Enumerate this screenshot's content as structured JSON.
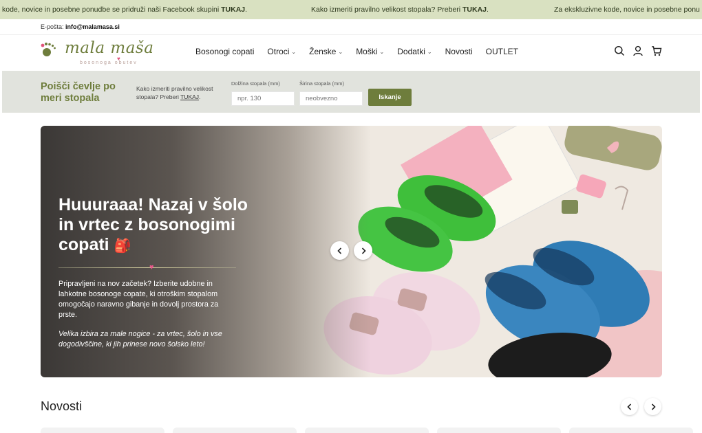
{
  "announcement": {
    "items": [
      {
        "prefix": "kode, novice in posebne ponudbe se pridruži naši Facebook skupini ",
        "bold": "TUKAJ",
        "suffix": "."
      },
      {
        "prefix": "Kako izmeriti pravilno velikost stopala? Preberi ",
        "bold": "TUKAJ",
        "suffix": "."
      },
      {
        "prefix": "Za ekskluzivne kode, novice in posebne ponu",
        "bold": "",
        "suffix": ""
      }
    ]
  },
  "contact": {
    "label": "E-pošta: ",
    "email": "info@malamasa.si"
  },
  "logo": {
    "text": "mala maša",
    "subtitle": "bosonoga obutev"
  },
  "nav": {
    "items": [
      {
        "label": "Bosonogi copati",
        "has_dropdown": false
      },
      {
        "label": "Otroci",
        "has_dropdown": true
      },
      {
        "label": "Ženske",
        "has_dropdown": true
      },
      {
        "label": "Moški",
        "has_dropdown": true
      },
      {
        "label": "Dodatki",
        "has_dropdown": true
      },
      {
        "label": "Novosti",
        "has_dropdown": false
      },
      {
        "label": "OUTLET",
        "has_dropdown": false
      }
    ],
    "chevron": "⌄"
  },
  "header_icons": [
    "search-icon",
    "user-icon",
    "cart-icon"
  ],
  "filter": {
    "title": "Poišči čevlje po meri stopala",
    "help_text": "Kako izmeriti pravilno velikost stopala? Preberi ",
    "help_link": "TUKAJ",
    "help_end": ".",
    "length_label": "Dolžina stopala (mm)",
    "length_placeholder": "npr. 130",
    "width_label": "Širina stopala (mm)",
    "width_placeholder": "neobvezno",
    "button": "Iskanje"
  },
  "hero": {
    "title": "Huuuraaa! Nazaj v šolo in vrtec z bosonogimi copati",
    "title_emoji": "🎒",
    "text": "Pripravljeni na nov začetek? Izberite udobne in lahkotne bosonoge copate, ki otroškim stopalom omogočajo naravno gibanje in dovolj prostora za prste.",
    "text_italic": "Velika izbira za male nogice - za vrtec, šolo in vse dogodivščine, ki jih prinese novo šolsko leto!"
  },
  "section": {
    "title": "Novosti"
  },
  "colors": {
    "brand_green": "#6e7d3c",
    "announce_bg": "#d9e1c1",
    "filter_bg": "#e1e3dd",
    "accent_pink": "#e8578a"
  }
}
